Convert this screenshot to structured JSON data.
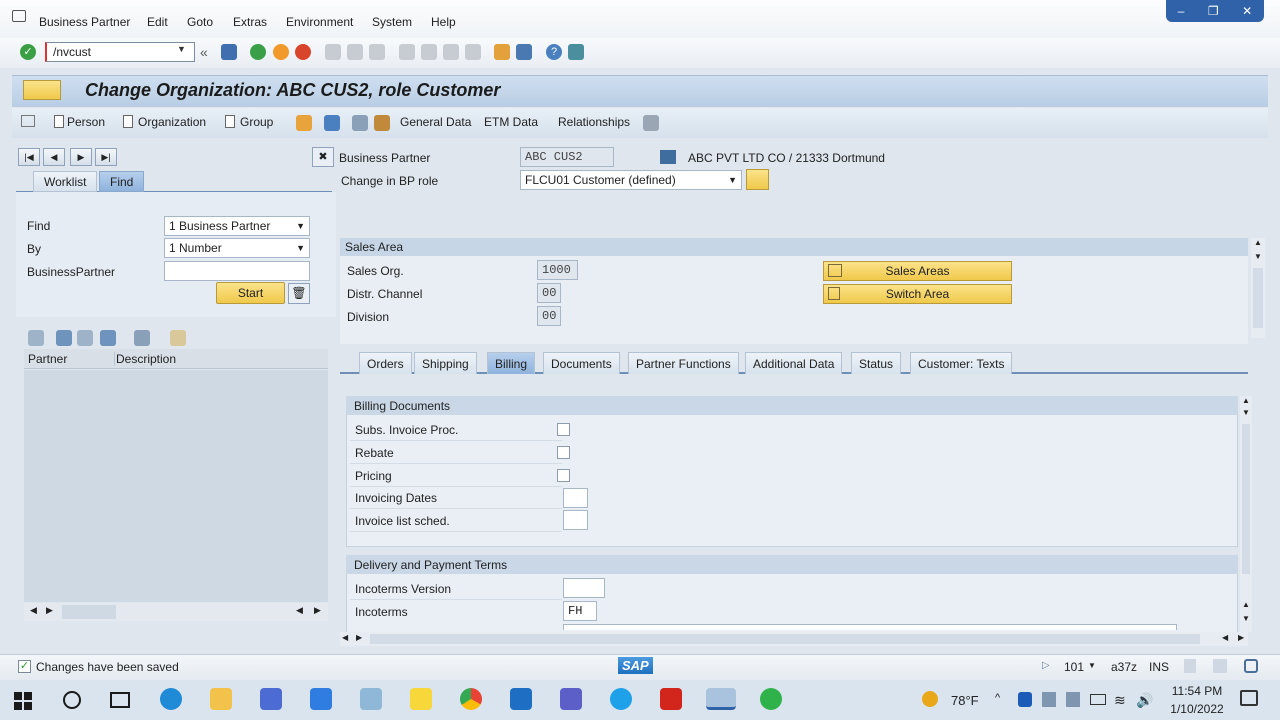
{
  "menu": [
    {
      "label": "Business Partner"
    },
    {
      "label": "Edit"
    },
    {
      "label": "Goto"
    },
    {
      "label": "Extras"
    },
    {
      "label": "Environment"
    },
    {
      "label": "System"
    },
    {
      "label": "Help"
    }
  ],
  "toolbar": {
    "command_value": "/nvcust"
  },
  "title": "Change Organization: ABC CUS2, role Customer",
  "app_toolbar": {
    "person": "Person",
    "organization": "Organization",
    "group": "Group",
    "general_data": "General Data",
    "etm_data": "ETM Data",
    "relationships": "Relationships"
  },
  "left": {
    "tabs": [
      "Worklist",
      "Find"
    ],
    "find_label": "Find",
    "find_value": "1 Business Partner",
    "by_label": "By",
    "by_value": "1 Number",
    "bp_label": "BusinessPartner",
    "bp_value": "",
    "start_label": "Start",
    "col_partner": "Partner",
    "col_description": "Description"
  },
  "header": {
    "bp_label": "Business Partner",
    "bp_value": "ABC CUS2",
    "bp_name": "ABC PVT LTD CO / 21333 Dortmund",
    "role_label": "Change in BP role",
    "role_value": "FLCU01 Customer (defined)"
  },
  "sales_area": {
    "title": "Sales Area",
    "sales_org_label": "Sales Org.",
    "sales_org_value": "1000",
    "distr_label": "Distr. Channel",
    "distr_value": "00",
    "division_label": "Division",
    "division_value": "00",
    "sales_areas_btn": "Sales Areas",
    "switch_area_btn": "Switch Area"
  },
  "tabs": [
    "Orders",
    "Shipping",
    "Billing",
    "Documents",
    "Partner Functions",
    "Additional Data",
    "Status",
    "Customer: Texts"
  ],
  "active_tab": "Billing",
  "billing_docs": {
    "title": "Billing Documents",
    "subs_invoice": "Subs. Invoice Proc.",
    "rebate": "Rebate",
    "pricing": "Pricing",
    "invoicing_dates": "Invoicing Dates",
    "invoice_list": "Invoice list sched."
  },
  "delivery": {
    "title": "Delivery and Payment Terms",
    "incoterms_version": "Incoterms Version",
    "incoterms": "Incoterms",
    "incoterms_value": "FH"
  },
  "status": {
    "message": "Changes have been saved",
    "client": "101",
    "server": "a37z",
    "mode": "INS",
    "logo": "SAP"
  },
  "taskbar": {
    "temperature": "78°F",
    "time": "11:54 PM",
    "date": "1/10/2022"
  },
  "colors": {
    "accent": "#2f62a8",
    "button_yellow": "#f0c94b",
    "status_ok": "#2e9b3a"
  }
}
